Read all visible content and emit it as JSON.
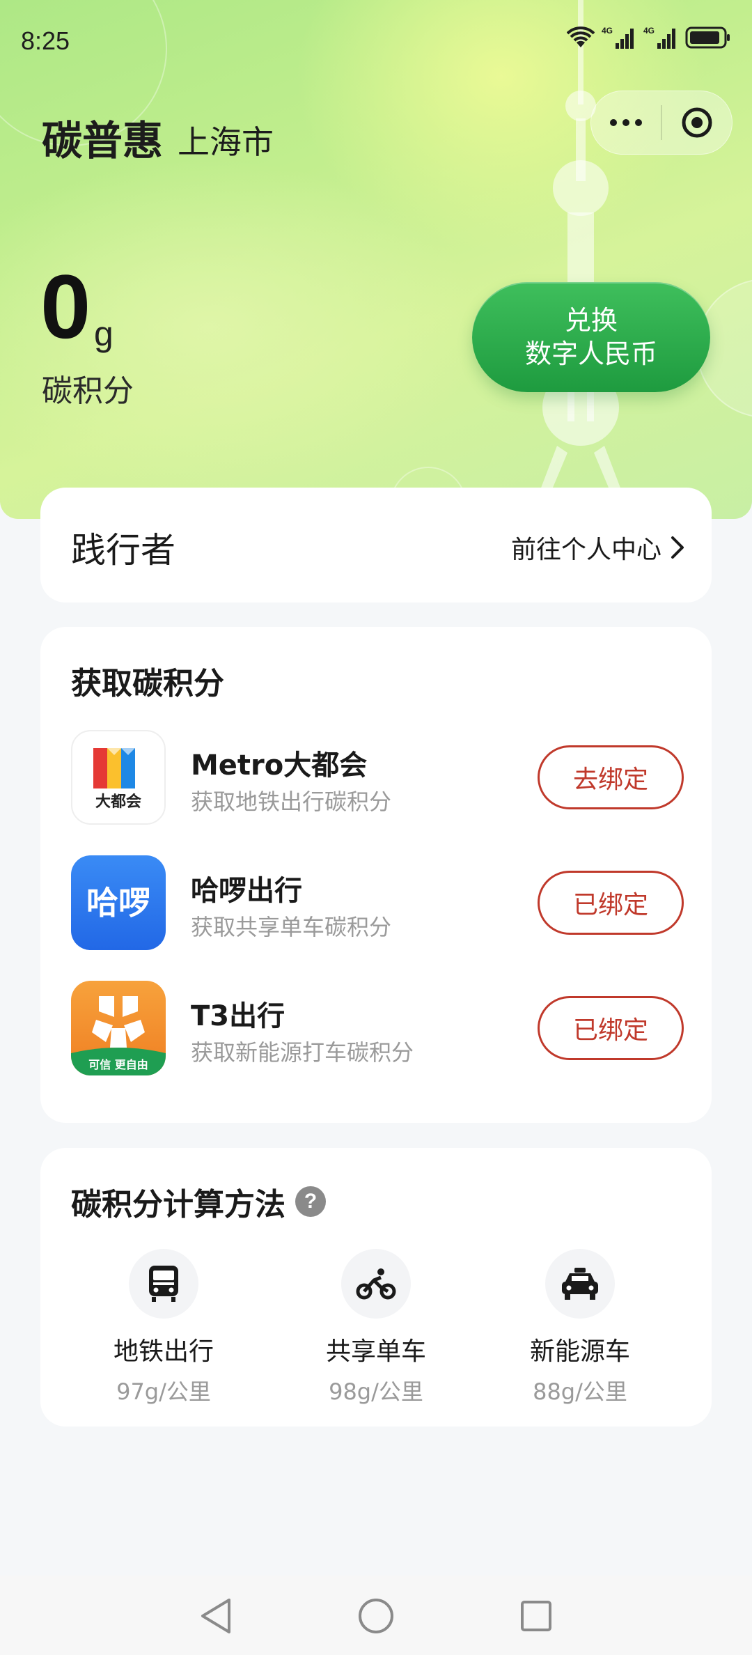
{
  "status_bar": {
    "time": "8:25",
    "icons": [
      "wifi-icon",
      "signal-4g-icon",
      "signal-4g-icon",
      "battery-icon"
    ]
  },
  "header": {
    "title": "碳普惠",
    "city": "上海市",
    "menu_icon": "more-dots-icon",
    "close_icon": "target-circle-icon"
  },
  "points": {
    "value": "0",
    "unit": "g",
    "label": "碳积分"
  },
  "exchange_button": {
    "line1": "兑换",
    "line2": "数字人民币"
  },
  "profile": {
    "name": "践行者",
    "link_label": "前往个人中心"
  },
  "earn": {
    "title": "获取碳积分",
    "items": [
      {
        "name": "Metro大都会",
        "desc": "获取地铁出行碳积分",
        "button": "去绑定",
        "logo_text": "大都会",
        "icon": "metro-app-icon"
      },
      {
        "name": "哈啰出行",
        "desc": "获取共享单车碳积分",
        "button": "已绑定",
        "logo_text": "哈啰",
        "icon": "hello-app-icon"
      },
      {
        "name": "T3出行",
        "desc": "获取新能源打车碳积分",
        "button": "已绑定",
        "logo_text": "可信 更自由",
        "icon": "t3-app-icon"
      }
    ]
  },
  "calc": {
    "title": "碳积分计算方法",
    "help_glyph": "?",
    "items": [
      {
        "name": "地铁出行",
        "rate": "97g/公里",
        "icon": "subway-icon"
      },
      {
        "name": "共享单车",
        "rate": "98g/公里",
        "icon": "bicycle-icon"
      },
      {
        "name": "新能源车",
        "rate": "88g/公里",
        "icon": "taxi-icon"
      }
    ]
  },
  "nav": {
    "icons": [
      "back-triangle-icon",
      "home-circle-icon",
      "recents-square-icon"
    ]
  },
  "colors": {
    "accent_green": "#1e9b3f",
    "bind_red": "#c0392b",
    "hello_blue": "#2f7cf0",
    "t3_orange": "#f08a2c"
  }
}
